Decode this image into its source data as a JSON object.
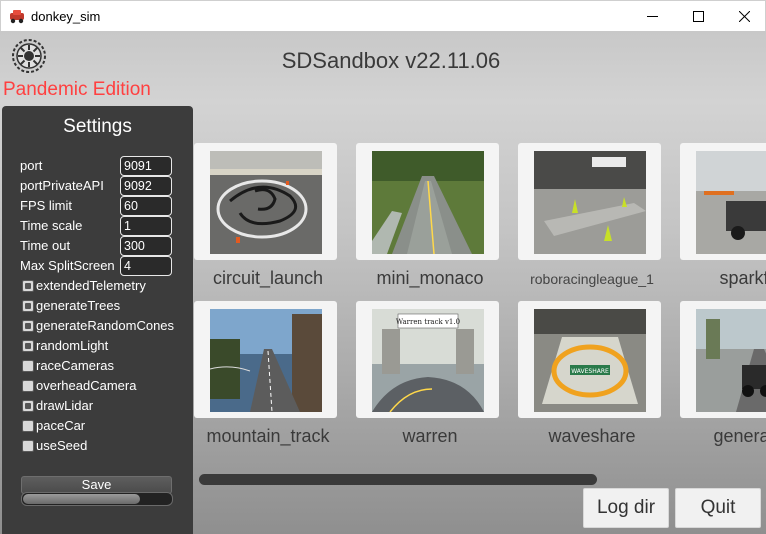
{
  "window": {
    "title": "donkey_sim",
    "controls": [
      "minimize-icon",
      "maximize-icon",
      "close-icon"
    ]
  },
  "header": {
    "title": "SDSandbox v22.11.06",
    "edition": "Pandemic Edition",
    "logo_icon": "gear-wheel-icon"
  },
  "settings": {
    "title": "Settings",
    "fields": [
      {
        "label": "port",
        "value": "9091"
      },
      {
        "label": "portPrivateAPI",
        "value": "9092"
      },
      {
        "label": "FPS limit",
        "value": "60"
      },
      {
        "label": "Time scale",
        "value": "1"
      },
      {
        "label": "Time out",
        "value": "300"
      },
      {
        "label": "Max SplitScreen",
        "value": "4"
      }
    ],
    "checkboxes": [
      {
        "label": "extendedTelemetry",
        "checked": true
      },
      {
        "label": "generateTrees",
        "checked": true
      },
      {
        "label": "generateRandomCones",
        "checked": true
      },
      {
        "label": "randomLight",
        "checked": true
      },
      {
        "label": "raceCameras",
        "checked": false
      },
      {
        "label": "overheadCamera",
        "checked": false
      },
      {
        "label": "drawLidar",
        "checked": true
      },
      {
        "label": "paceCar",
        "checked": false
      },
      {
        "label": "useSeed",
        "checked": false
      }
    ],
    "save_label": "Save",
    "progress": 0.78
  },
  "tracks": [
    {
      "name": "circuit_launch"
    },
    {
      "name": "mini_monaco"
    },
    {
      "name": "roboracingleague_1"
    },
    {
      "name": "sparkfun"
    },
    {
      "name": "mountain_track"
    },
    {
      "name": "warren",
      "sign_text": "Warren track v1.0"
    },
    {
      "name": "waveshare",
      "logo_text": "WAVESHARE"
    },
    {
      "name": "generated"
    }
  ],
  "buttons": {
    "log_dir": "Log dir",
    "quit": "Quit"
  },
  "colors": {
    "edition": "#ff4040",
    "panel": "#3c3c3c"
  }
}
